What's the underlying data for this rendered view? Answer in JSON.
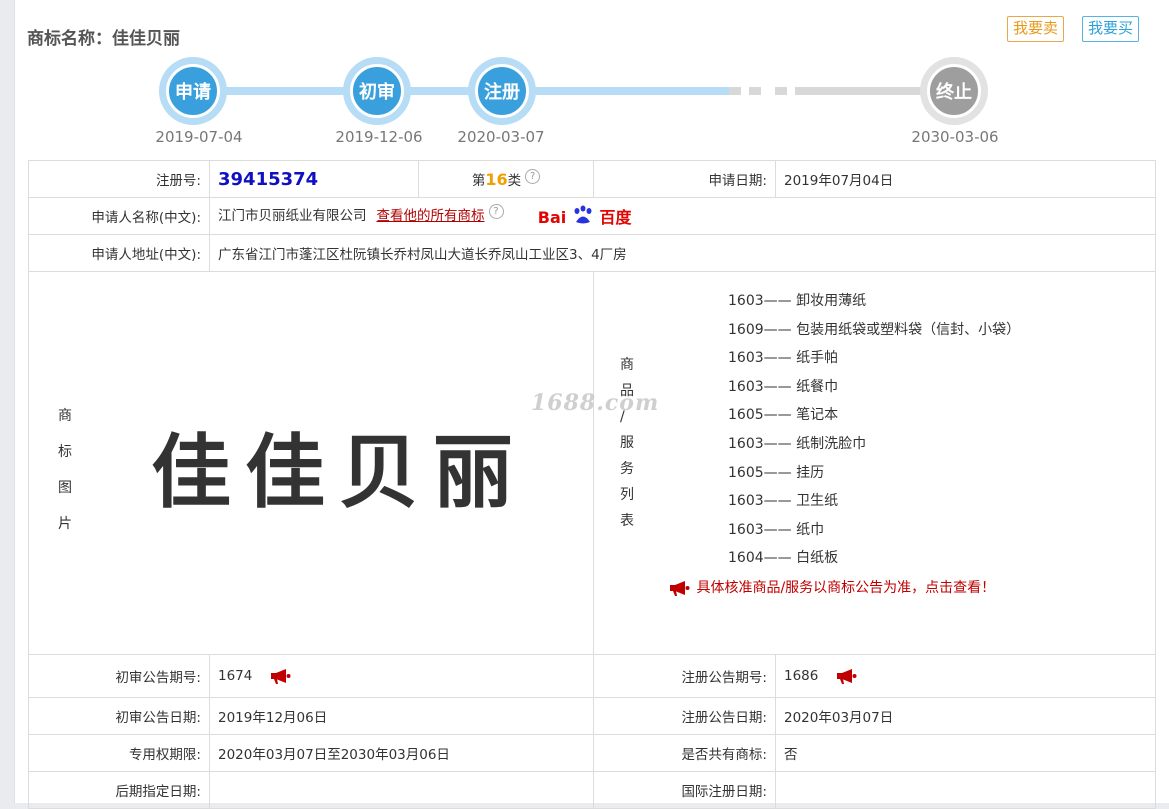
{
  "header": {
    "title": "商标名称：佳佳贝丽",
    "sell_label": "我要卖",
    "buy_label": "我要买"
  },
  "timeline": [
    {
      "label": "申请",
      "date": "2019-07-04"
    },
    {
      "label": "初审",
      "date": "2019-12-06"
    },
    {
      "label": "注册",
      "date": "2020-03-07"
    },
    {
      "label": "终止",
      "date": "2030-03-06"
    }
  ],
  "info": {
    "reg_no_label": "注册号:",
    "reg_no": "39415374",
    "class_prefix": "第",
    "class_num": "16",
    "class_suffix": "类",
    "apply_date_label": "申请日期:",
    "apply_date": "2019年07月04日",
    "applicant_label": "申请人名称(中文):",
    "applicant": "江门市贝丽纸业有限公司",
    "view_all_link": "查看他的所有商标",
    "baidu_a": "Bai",
    "baidu_b": "百度",
    "address_label": "申请人地址(中文):",
    "address": "广东省江门市蓬江区杜阮镇长乔村凤山大道长乔凤山工业区3、4厂房",
    "mark_image_label": [
      "商",
      "标",
      "图",
      "片"
    ],
    "mark_text": "佳佳贝丽",
    "goods_label": [
      "商",
      "品",
      "/",
      "服",
      "务",
      "列",
      "表"
    ],
    "goods": [
      "1603—— 卸妆用薄纸",
      "1609—— 包装用纸袋或塑料袋（信封、小袋）",
      "1603—— 纸手帕",
      "1603—— 纸餐巾",
      "1605—— 笔记本",
      "1603—— 纸制洗脸巾",
      "1605—— 挂历",
      "1603—— 卫生纸",
      "1603—— 纸巾",
      "1604—— 白纸板"
    ],
    "goods_note": "具体核准商品/服务以商标公告为准，点击查看！",
    "prelim_no_label": "初审公告期号:",
    "prelim_no": "1674",
    "reg_notice_no_label": "注册公告期号:",
    "reg_notice_no": "1686",
    "prelim_date_label": "初审公告日期:",
    "prelim_date": "2019年12月06日",
    "reg_notice_date_label": "注册公告日期:",
    "reg_notice_date": "2020年03月07日",
    "exclusive_label": "专用权期限:",
    "exclusive": "2020年03月07日至2030年03月06日",
    "shared_label": "是否共有商标:",
    "shared": "否",
    "later_label": "后期指定日期:",
    "intl_label": "国际注册日期:"
  },
  "watermark": "1688.com"
}
